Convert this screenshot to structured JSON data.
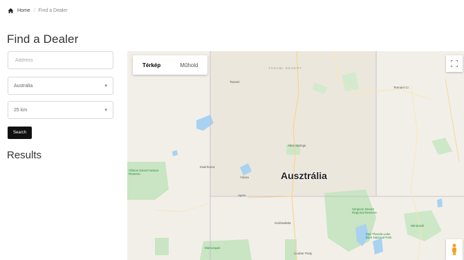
{
  "breadcrumb": {
    "home": "Home",
    "separator": "/",
    "current": "Find a Dealer"
  },
  "page": {
    "title": "Find a Dealer",
    "results_title": "Results"
  },
  "form": {
    "address_placeholder": "Address",
    "country_value": "Australia",
    "radius_value": "25 km",
    "search_label": "Search"
  },
  "map": {
    "tab_map": "Térkép",
    "tab_satellite": "Műhold",
    "country_label": "Ausztrália",
    "labels": {
      "region": "TANAMI DESERT",
      "tanami": "Tanami",
      "tennant": "Tennant Cr.",
      "alice": "Alice Springs",
      "kiwirrkurra": "Kiwirrkurra",
      "yulara": "Yulara",
      "ayers": "Ayers",
      "gibson": "Gibson Desert Nature Reserve",
      "simpson": "Simpson Desert Regional Reserve",
      "mamungari": "Mamungari",
      "oodnadatta": "Oodnadatta",
      "coober": "Coober Pedy",
      "kati": "Kati Thanda-Lake Eyre National Park",
      "windorah": "Windorah"
    }
  }
}
